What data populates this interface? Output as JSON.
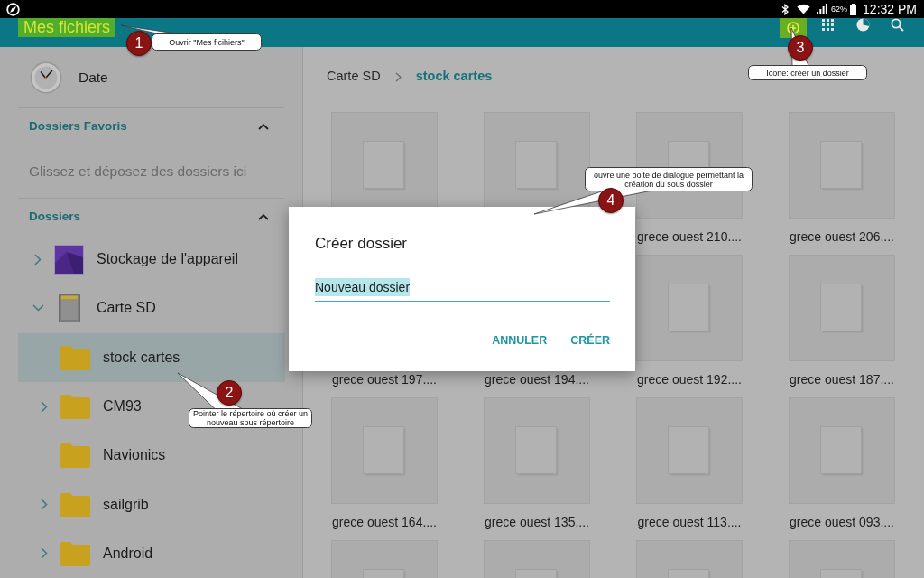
{
  "status_bar": {
    "battery": "62%",
    "time": "12:32 PM"
  },
  "app_bar": {
    "title": "Mes fichiers",
    "title_highlighted": true,
    "new_folder_highlighted": true
  },
  "sidebar": {
    "sort": {
      "label": "Date"
    },
    "favorites": {
      "title": "Dossiers Favoris",
      "expanded": true,
      "hint": "Glissez et déposez des dossiers ici"
    },
    "folders": {
      "title": "Dossiers",
      "expanded": true,
      "tree": [
        {
          "kind": "device",
          "label": "Stockage de l'appareil",
          "expanded": false,
          "selected": false
        },
        {
          "kind": "sd-card",
          "label": "Carte SD",
          "expanded": true,
          "selected": false,
          "children": [
            {
              "kind": "folder",
              "label": "stock cartes",
              "selected": true
            },
            {
              "kind": "folder",
              "label": "CM93",
              "expanded": false,
              "selected": false
            },
            {
              "kind": "folder",
              "label": "Navionics",
              "selected": false
            },
            {
              "kind": "folder",
              "label": "sailgrib",
              "expanded": false,
              "selected": false
            },
            {
              "kind": "folder",
              "label": "Android",
              "expanded": false,
              "selected": false
            }
          ]
        }
      ]
    }
  },
  "breadcrumb": [
    {
      "label": "Carte SD",
      "selected": false
    },
    {
      "label": "stock cartes",
      "selected": true
    }
  ],
  "files": [
    {
      "kind": "file"
    },
    {
      "kind": "file"
    },
    {
      "kind": "file",
      "label": "grece ouest 210...."
    },
    {
      "kind": "file",
      "label": "grece ouest 206...."
    },
    {
      "kind": "file",
      "label": "grece ouest 197...."
    },
    {
      "kind": "file",
      "label": "grece ouest 194...."
    },
    {
      "kind": "file",
      "label": "grece ouest 192...."
    },
    {
      "kind": "file",
      "label": "grece ouest 187...."
    },
    {
      "kind": "file",
      "label": "grece ouest 164...."
    },
    {
      "kind": "file",
      "label": "grece ouest 135...."
    },
    {
      "kind": "file",
      "label": "grece ouest 113...."
    },
    {
      "kind": "file",
      "label": "grece ouest 093...."
    },
    {
      "kind": "file"
    },
    {
      "kind": "file"
    },
    {
      "kind": "file"
    },
    {
      "kind": "file"
    }
  ],
  "dialog": {
    "title": "Créer dossier",
    "field": {
      "value": "Nouveau dossier",
      "text_selected": true
    },
    "buttons": [
      "ANNULER",
      "CRÉER"
    ]
  },
  "annotations": [
    {
      "number": "1",
      "text": "Ouvrir \"Mes ficihiers\""
    },
    {
      "number": "2",
      "text": "Pointer le répertoire où créer un nouveau sous répertoire"
    },
    {
      "number": "3",
      "text": "Icone: créer un dossier"
    },
    {
      "number": "4",
      "text": "ouvre une boite de dialogue permettant la création du sous dossier"
    }
  ]
}
